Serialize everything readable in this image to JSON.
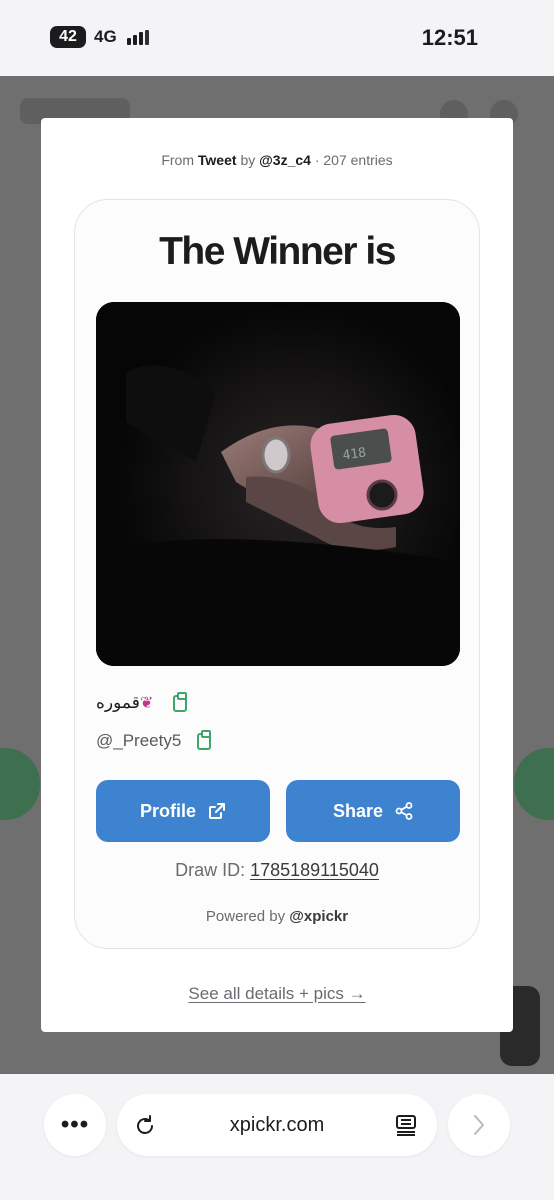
{
  "status_bar": {
    "battery": "42",
    "network": "4G",
    "time": "12:51"
  },
  "modal": {
    "meta": {
      "from": "From",
      "source": "Tweet",
      "by": "by",
      "author": "@3z_c4",
      "separator": "·",
      "entries": "207 entries"
    },
    "title": "The Winner is",
    "winner": {
      "display_name": "قموره",
      "handle": "@_Preety5",
      "photo_description": "hand wearing ring holding pink tally counter"
    },
    "buttons": {
      "profile": "Profile",
      "share": "Share"
    },
    "draw_id": {
      "label": "Draw ID:",
      "value": "1785189115040"
    },
    "powered": {
      "prefix": "Powered by",
      "brand": "@xpickr"
    },
    "details_link": "See all details + pics →"
  },
  "browser": {
    "url": "xpickr.com",
    "menu": "•••"
  },
  "colors": {
    "accent": "#3d83cf",
    "copy_icon": "#3fa56b",
    "backdrop": "#6f6f6f"
  },
  "icons": [
    "battery-icon",
    "signal-icon",
    "fairy-icon",
    "clipboard-icon",
    "external-link-icon",
    "share-icon",
    "reload-icon",
    "reader-mode-icon",
    "chevron-right-icon"
  ]
}
